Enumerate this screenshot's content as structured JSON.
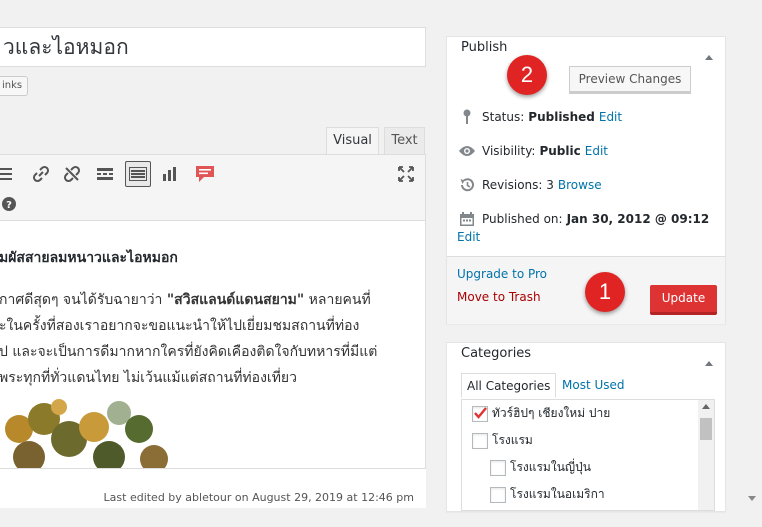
{
  "editor": {
    "title_value": "วและไอหมอก",
    "links_label": "inks",
    "tab_visual": "Visual",
    "tab_text": "Text",
    "heading": "มผัสสายลมหนาวและไอหมอก",
    "para_line1_a": "กาศดีสุดๆ จนได้รับฉายาว่า ",
    "para_line1_bold": "\"สวิสแลนด์แดนสยาม\"",
    "para_line1_b": " หลายคนที่",
    "para_line2": "ะในครั้งที่สองเราอยากจะขอแนะนำให้ไปเยี่ยมชมสถานที่ท่อง",
    "para_line3": "ป และจะเป็นการดีมากหากใครที่ยังคิดเคืองติดใจกับทหารที่มีแต่",
    "para_line4": "พระทุกที่ทั่วแดนไทย ไม่เว้นแม้แต่สถานที่ท่องเที่ยว",
    "last_edited": "Last edited by abletour on August 29, 2019 at 12:46 pm"
  },
  "publish": {
    "title": "Publish",
    "preview_button": "Preview Changes",
    "status_label": "Status:",
    "status_value": "Published",
    "visibility_label": "Visibility:",
    "visibility_value": "Public",
    "revisions_label": "Revisions: 3",
    "revisions_link": "Browse",
    "published_on_label": "Published on:",
    "published_on_value": "Jan 30, 2012 @ 09:12",
    "edit_link": "Edit",
    "upgrade_link": "Upgrade to Pro",
    "trash_link": "Move to Trash",
    "update_button": "Update"
  },
  "badges": {
    "one": "1",
    "two": "2"
  },
  "categories": {
    "title": "Categories",
    "tab_all": "All Categories",
    "tab_most_used": "Most Used",
    "items": [
      {
        "label": "ทัวร์ฮิปๆ เชียงใหม่ ปาย",
        "checked": true
      },
      {
        "label": "โรงแรม",
        "checked": false
      },
      {
        "label": "โรงแรมในญี่ปุ่น",
        "checked": false
      },
      {
        "label": "โรงแรมในอเมริกา",
        "checked": false
      }
    ]
  },
  "colors": {
    "link": "#0073aa",
    "trash": "#aa0000",
    "update": "#dd3333",
    "badge": "#e02424"
  }
}
